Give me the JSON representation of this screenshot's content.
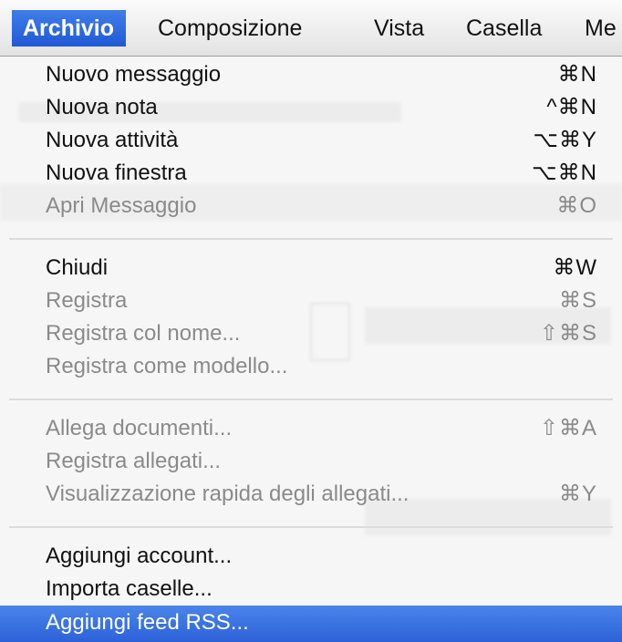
{
  "menubar": {
    "items": [
      {
        "label": "Archivio",
        "active": true
      },
      {
        "label": "Composizione"
      },
      {
        "label": "Vista"
      },
      {
        "label": "Casella"
      },
      {
        "label": "Me"
      }
    ]
  },
  "menu": {
    "group1": [
      {
        "label": "Nuovo messaggio",
        "shortcut": "⌘N"
      },
      {
        "label": "Nuova nota",
        "shortcut": "^⌘N"
      },
      {
        "label": "Nuova attività",
        "shortcut": "⌥⌘Y"
      },
      {
        "label": "Nuova finestra",
        "shortcut": "⌥⌘N"
      },
      {
        "label": "Apri Messaggio",
        "shortcut": "⌘O",
        "disabled": true
      }
    ],
    "group2": [
      {
        "label": "Chiudi",
        "shortcut": "⌘W"
      },
      {
        "label": "Registra",
        "shortcut": "⌘S",
        "disabled": true
      },
      {
        "label": "Registra col nome...",
        "shortcut": "⇧⌘S",
        "disabled": true
      },
      {
        "label": "Registra come modello...",
        "disabled": true
      }
    ],
    "group3": [
      {
        "label": "Allega documenti...",
        "shortcut": "⇧⌘A",
        "disabled": true
      },
      {
        "label": "Registra allegati...",
        "disabled": true
      },
      {
        "label": "Visualizzazione rapida degli allegati...",
        "shortcut": "⌘Y",
        "disabled": true
      }
    ],
    "group4": [
      {
        "label": "Aggiungi account..."
      },
      {
        "label": "Importa caselle..."
      },
      {
        "label": "Aggiungi feed RSS...",
        "highlighted": true
      }
    ]
  },
  "colors": {
    "highlight": "#2d62d8",
    "disabled_text": "#8a8a8a"
  }
}
